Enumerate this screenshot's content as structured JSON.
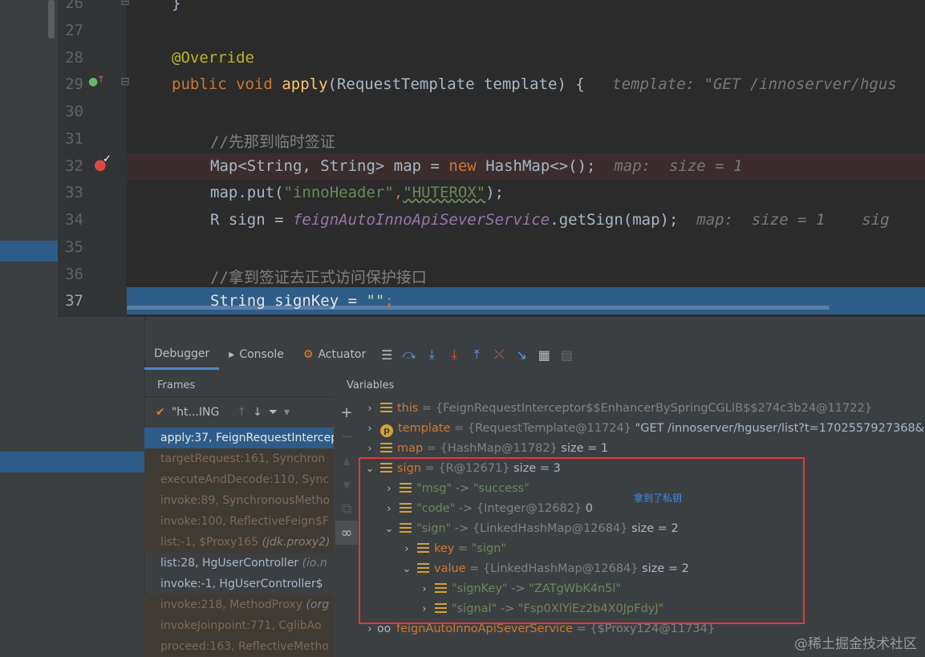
{
  "editor": {
    "lines": [
      {
        "num": "26"
      },
      {
        "num": "27"
      },
      {
        "num": "28"
      },
      {
        "num": "29"
      },
      {
        "num": "30"
      },
      {
        "num": "31"
      },
      {
        "num": "32"
      },
      {
        "num": "33"
      },
      {
        "num": "34"
      },
      {
        "num": "35"
      },
      {
        "num": "36"
      },
      {
        "num": "37"
      }
    ],
    "code": {
      "l26": "}",
      "l28": "@Override",
      "l29_kw1": "public",
      "l29_kw2": "void",
      "l29_fn": "apply",
      "l29_rest": "(RequestTemplate template) {",
      "l29_hint": "template: \"GET /innoserver/hgus",
      "l31": "//先那到临时签证",
      "l32_a": "Map<String, String> map = ",
      "l32_kw": "new",
      "l32_b": " HashMap<>();",
      "l32_hint": "map:  size = 1",
      "l33_a": "map.put(",
      "l33_s1": "\"innoHeader\"",
      "l33_comma": ",",
      "l33_s2": "\"HUTEROX\"",
      "l33_b": ");",
      "l34_a": "R sign = ",
      "l34_field": "feignAutoInnoApiSeverService",
      "l34_b": ".getSign(map);",
      "l34_hint": "map:  size = 1    sig",
      "l36": "//拿到签证去正式访问保护接口",
      "l37_a": "String signKey = ",
      "l37_s": "\"\"",
      "l37_b": ";"
    }
  },
  "tabs": [
    {
      "label": "Debugger"
    },
    {
      "label": "Console"
    },
    {
      "label": "Actuator"
    }
  ],
  "frames_header": "Frames",
  "variables_header": "Variables",
  "thread": "\"ht...ING",
  "frames": [
    {
      "text": "apply:37, FeignRequestIntercep",
      "pkg": ""
    },
    {
      "text": "targetRequest:161, Synchron",
      "pkg": ""
    },
    {
      "text": "executeAndDecode:110, Sync",
      "pkg": ""
    },
    {
      "text": "invoke:89, SynchronousMetho",
      "pkg": ""
    },
    {
      "text": "invoke:100, ReflectiveFeign$F",
      "pkg": ""
    },
    {
      "text": "list:-1, $Proxy165 ",
      "pkg": "(jdk.proxy2)"
    },
    {
      "text": "list:28, HgUserController ",
      "pkg": "(io.n"
    },
    {
      "text": "invoke:-1, HgUserController$",
      "pkg": ""
    },
    {
      "text": "invoke:218, MethodProxy ",
      "pkg": "(org"
    },
    {
      "text": "invokeJoinpoint:771, CglibAo",
      "pkg": ""
    },
    {
      "text": "proceed:163, ReflectiveMetho",
      "pkg": ""
    }
  ],
  "variables": {
    "this": {
      "name": "this",
      "eq": " = ",
      "val": "{FeignRequestInterceptor$$EnhancerBySpringCGLIB$$274c3b24@11722}"
    },
    "template": {
      "name": "template",
      "eq": " = ",
      "val": "{RequestTemplate@11724} ",
      "extra": "\"GET /innoserver/hguser/list?t=1702557927368&p"
    },
    "map": {
      "name": "map",
      "eq": " = ",
      "val": "{HashMap@11782} ",
      "extra": " size = 1"
    },
    "sign": {
      "name": "sign",
      "eq": " = ",
      "val": "{R@12671} ",
      "extra": " size = 3"
    },
    "msg": {
      "key": "\"msg\"",
      "arrow": " -> ",
      "val": "\"success\""
    },
    "code": {
      "key": "\"code\"",
      "arrow": " -> ",
      "val": "{Integer@12682} ",
      "extra": "0"
    },
    "signmap": {
      "key": "\"sign\"",
      "arrow": " -> ",
      "val": "{LinkedHashMap@12684} ",
      "extra": " size = 2"
    },
    "key": {
      "name": "key",
      "eq": " = ",
      "val": "\"sign\""
    },
    "value": {
      "name": "value",
      "eq": " = ",
      "val": "{LinkedHashMap@12684} ",
      "extra": " size = 2"
    },
    "signKey": {
      "key": "\"signKey\"",
      "arrow": " -> ",
      "val": "\"ZATgWbK4n5l\""
    },
    "signal": {
      "key": "\"signal\"",
      "arrow": " -> ",
      "val": "\"Fsp0XlYiEz2b4X0JpFdyJ\""
    },
    "service": {
      "name": "feignAutoInnoApiSeverService",
      "eq": " = ",
      "val": "{$Proxy124@11734}"
    }
  },
  "annotation_note": "拿到了私钥",
  "watermark": "@稀土掘金技术社区",
  "colors": {
    "highlight_box": "#e03a3a",
    "selection": "#2d5c88",
    "accent": "#4a88c7"
  }
}
